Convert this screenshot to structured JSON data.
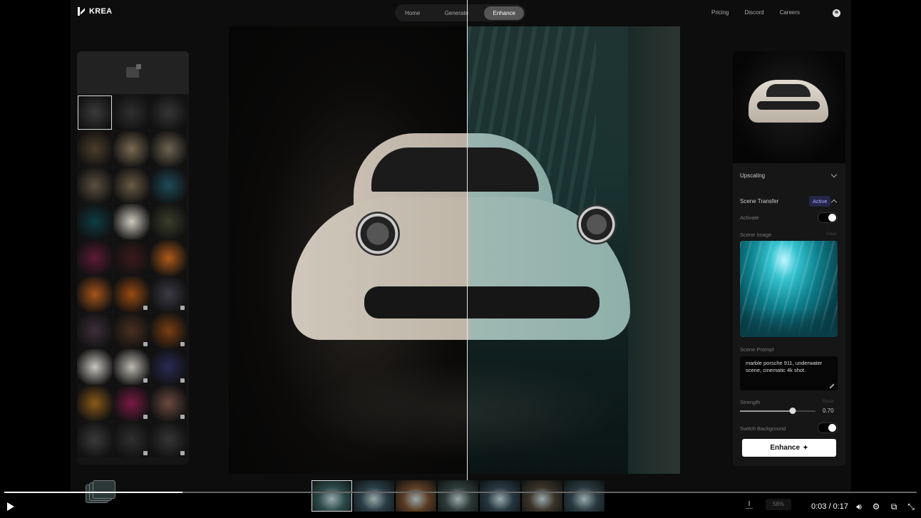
{
  "app": {
    "brand": "KREA"
  },
  "nav": {
    "tabs": [
      {
        "label": "Home"
      },
      {
        "label": "Generate"
      },
      {
        "label": "Enhance",
        "active": true
      }
    ],
    "links": [
      "Pricing",
      "Discord",
      "Careers"
    ]
  },
  "panel": {
    "upscaling_label": "Upscaling",
    "scene_transfer_label": "Scene Transfer",
    "scene_transfer_badge": "Active",
    "activate_label": "Activate",
    "activate_on": true,
    "scene_image_label": "Scene Image",
    "scene_image_clear": "Clear",
    "scene_prompt_label": "Scene Prompt",
    "scene_prompt_value": "marble porsche 911, underwater scene, cinematic 4k shot.",
    "strength_label": "Strength",
    "strength_reset": "Reset",
    "strength_value": "0.70",
    "strength_fraction": 0.7,
    "switch_background_label": "Switch Background",
    "switch_background_on": true,
    "enhance_button": "Enhance"
  },
  "canvas_toolbar": {
    "zoom_value": "58%"
  },
  "player": {
    "time": "0:03 / 0:17",
    "progress_fraction": 0.195
  },
  "colors": {
    "accent_badge": "#a9a9ff",
    "background": "#0d0d0d"
  },
  "icons": [
    "krea-logo-icon",
    "user-avatar-icon",
    "upload-image-icon",
    "chevron-down-icon",
    "chevron-up-icon",
    "pencil-icon",
    "sparkle-icon",
    "download-icon",
    "play-icon",
    "volume-icon",
    "gear-icon",
    "pip-icon",
    "fullscreen-exit-icon"
  ]
}
